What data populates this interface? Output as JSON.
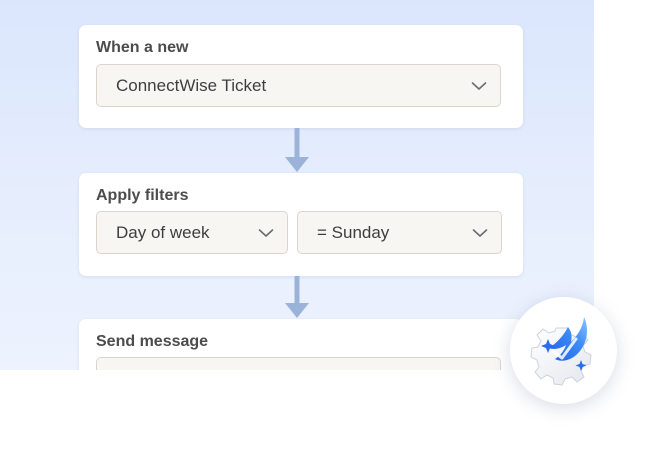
{
  "trigger": {
    "title": "When a new",
    "select_value": "ConnectWise Ticket"
  },
  "filters": {
    "title": "Apply filters",
    "field_value": "Day of week",
    "condition_value": "= Sunday"
  },
  "action": {
    "title": "Send message"
  },
  "icons": {
    "connector": "arrow-down-icon",
    "dropdown": "chevron-down-icon",
    "badge": "ai-sparkle-gear-icon"
  },
  "colors": {
    "panel_background": "#dbe6fd",
    "connector_arrow": "#9bb3d9",
    "badge_accent": "#2a6cf0"
  }
}
